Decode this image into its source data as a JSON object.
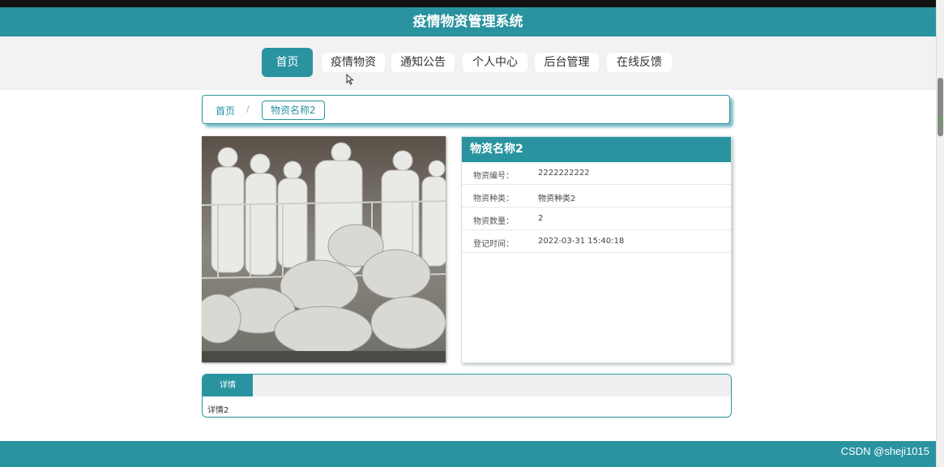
{
  "header": {
    "title": "疫情物资管理系统"
  },
  "nav": {
    "items": [
      {
        "label": "首页",
        "active": true
      },
      {
        "label": "疫情物资"
      },
      {
        "label": "通知公告"
      },
      {
        "label": "个人中心"
      },
      {
        "label": "后台管理"
      },
      {
        "label": "在线反馈"
      }
    ]
  },
  "breadcrumb": {
    "home": "首页",
    "separator": "/",
    "current": "物资名称2"
  },
  "info": {
    "title": "物资名称2",
    "rows": [
      {
        "label": "物资编号：",
        "value": "2222222222"
      },
      {
        "label": "物资种类：",
        "value": "物资种类2"
      },
      {
        "label": "物资数量：",
        "value": "2"
      },
      {
        "label": "登记时间：",
        "value": "2022-03-31 15:40:18"
      }
    ]
  },
  "detail": {
    "tab_label": "详情",
    "content": "详情2"
  },
  "watermark": "CSDN @sheji1015",
  "colors": {
    "accent": "#2a93a0",
    "nav_bg": "#f2f2f2"
  }
}
